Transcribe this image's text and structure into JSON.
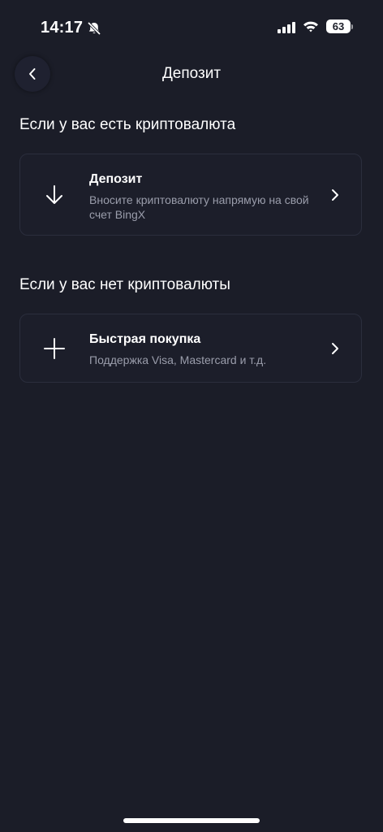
{
  "status_bar": {
    "time": "14:17",
    "battery": "63"
  },
  "header": {
    "title": "Депозит"
  },
  "sections": [
    {
      "title": "Если у вас есть криптовалюта",
      "card": {
        "icon": "arrow-down-icon",
        "title": "Депозит",
        "description": "Вносите криптовалюту напрямую на свой счет BingX"
      }
    },
    {
      "title": "Если у вас нет криптовалюты",
      "card": {
        "icon": "plus-icon",
        "title": "Быстрая покупка",
        "description": "Поддержка Visa, Mastercard и т.д."
      }
    }
  ],
  "colors": {
    "background": "#1b1d28",
    "card_border": "#2b2e3d",
    "secondary_text": "#9a9dab"
  }
}
